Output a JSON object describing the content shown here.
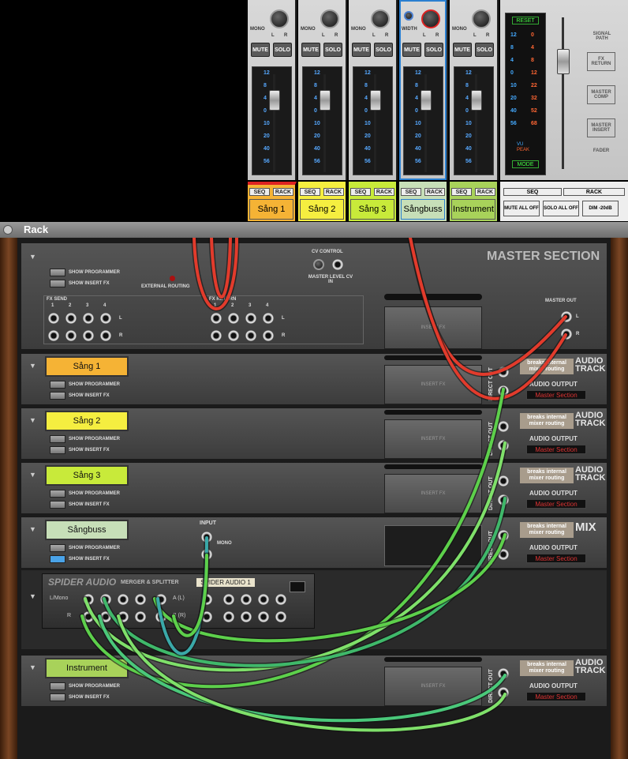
{
  "mixer": {
    "channels": [
      {
        "name": "Sång 1",
        "color": "#f5b335",
        "mute": "MUTE",
        "solo": "SOLO",
        "seq": "SEQ",
        "rack": "RACK",
        "knob_label": "MONO"
      },
      {
        "name": "Sång 2",
        "color": "#f5ee40",
        "mute": "MUTE",
        "solo": "SOLO",
        "seq": "SEQ",
        "rack": "RACK",
        "knob_label": "MONO"
      },
      {
        "name": "Sång 3",
        "color": "#c8ea3a",
        "mute": "MUTE",
        "solo": "SOLO",
        "seq": "SEQ",
        "rack": "RACK",
        "knob_label": "MONO"
      },
      {
        "name": "Sångbuss",
        "color": "#c7dfb8",
        "mute": "MUTE",
        "solo": "SOLO",
        "seq": "SEQ",
        "rack": "RACK",
        "knob_label": "WIDTH"
      },
      {
        "name": "Instrument",
        "color": "#a8d25a",
        "mute": "MUTE",
        "solo": "SOLO",
        "seq": "SEQ",
        "rack": "RACK",
        "knob_label": "MONO"
      }
    ],
    "meter_scale": [
      "12",
      "8",
      "4",
      "0",
      "10",
      "20",
      "40",
      "56"
    ],
    "lr": [
      "L",
      "R"
    ],
    "master": {
      "reset": "RESET",
      "left_scale": [
        "12",
        "8",
        "4",
        "0",
        "10",
        "20",
        "40",
        "56"
      ],
      "right_scale": [
        "0",
        "4",
        "8",
        "12",
        "22",
        "32",
        "52",
        "68"
      ],
      "vu": "VU",
      "peak": "PEAK",
      "mode": "MODE",
      "signal_path": "SIGNAL PATH",
      "path": [
        "FX RETURN",
        "MASTER COMP",
        "MASTER INSERT",
        "FADER"
      ],
      "seq": "SEQ",
      "rack": "RACK",
      "mute_all": "MUTE ALL OFF",
      "solo_all": "SOLO ALL OFF",
      "dim": "DIM -20dB"
    }
  },
  "rack_header": {
    "title": "Rack"
  },
  "rack": {
    "master": {
      "title": "MASTER SECTION",
      "show_programmer": "SHOW PROGRAMMER",
      "show_insert": "SHOW INSERT FX",
      "external_routing": "EXTERNAL ROUTING",
      "cv_control": "CV CONTROL",
      "master_level_cv": "MASTER LEVEL CV IN",
      "fx_send": "FX SEND",
      "fx_return": "FX RETURN",
      "nums": [
        "1",
        "2",
        "3",
        "4"
      ],
      "master_out": "MASTER OUT",
      "insert_fx": "INSERT FX",
      "lr": [
        "L",
        "R"
      ]
    },
    "tracks": [
      {
        "name": "Sång 1",
        "color": "#f5b335",
        "type": "AUDIO TRACK",
        "output_label": "AUDIO OUTPUT",
        "output": "Master Section",
        "breaks": "breaks internal mixer routing",
        "direct_out": "DIRECT OUT"
      },
      {
        "name": "Sång 2",
        "color": "#f5ee40",
        "type": "AUDIO TRACK",
        "output_label": "AUDIO OUTPUT",
        "output": "Master Section",
        "breaks": "breaks internal mixer routing",
        "direct_out": "DIRECT OUT"
      },
      {
        "name": "Sång 3",
        "color": "#c8ea3a",
        "type": "AUDIO TRACK",
        "output_label": "AUDIO OUTPUT",
        "output": "Master Section",
        "breaks": "breaks internal mixer routing",
        "direct_out": "DIRECT OUT"
      },
      {
        "name": "Sångbuss",
        "color": "#c7dfb8",
        "type": "MIX",
        "output_label": "AUDIO OUTPUT",
        "output": "Master Section",
        "breaks": "breaks internal mixer routing",
        "direct_out": "DIRECT OUT"
      },
      {
        "name": "Instrument",
        "color": "#a8d25a",
        "type": "AUDIO TRACK",
        "output_label": "AUDIO OUTPUT",
        "output": "Master Section",
        "breaks": "breaks internal mixer routing",
        "direct_out": "DIRECT OUT"
      }
    ],
    "show_programmer": "SHOW PROGRAMMER",
    "show_insert": "SHOW INSERT FX",
    "insert_fx": "INSERT FX",
    "input": "INPUT",
    "mono": "MONO",
    "spider": {
      "brand": "SPIDER AUDIO",
      "sub": "MERGER & SPLITTER",
      "tag": "SPIDER AUDIO 1",
      "lmono": "L/Mono",
      "r": "R",
      "a": "A (L)",
      "b": "B (R)"
    }
  }
}
